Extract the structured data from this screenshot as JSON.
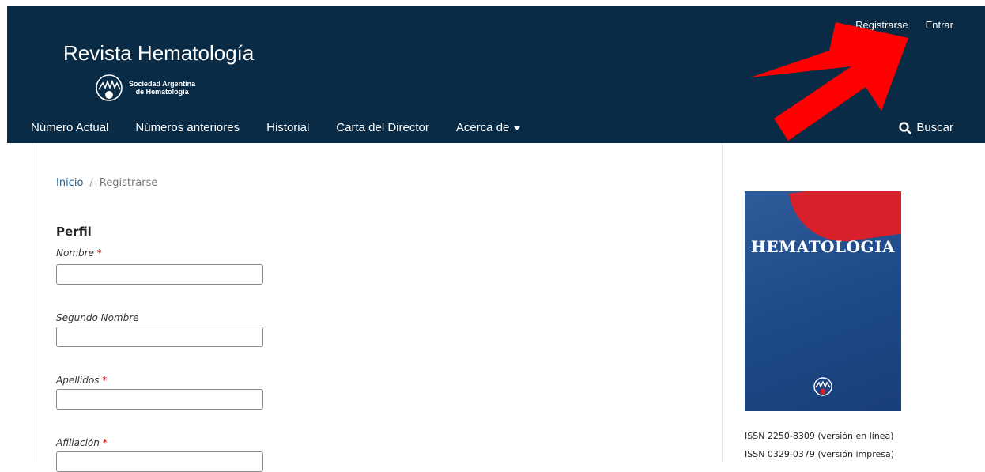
{
  "header": {
    "site_title": "Revista Hematología",
    "logo_line1": "Sociedad Argentina",
    "logo_line2": "de Hematología",
    "user_nav": {
      "register": "Registrarse",
      "login": "Entrar"
    },
    "nav_items": [
      "Número Actual",
      "Números anteriores",
      "Historial",
      "Carta del Director",
      "Acerca de"
    ],
    "search_label": "Buscar"
  },
  "breadcrumb": {
    "home": "Inicio",
    "separator": "/",
    "current": "Registrarse"
  },
  "form": {
    "legend": "Perfil",
    "fields": [
      {
        "label": "Nombre",
        "required": "*"
      },
      {
        "label": "Segundo Nombre",
        "required": ""
      },
      {
        "label": "Apellidos",
        "required": "*"
      },
      {
        "label": "Afiliación",
        "required": "*"
      }
    ]
  },
  "sidebar": {
    "cover_title": "HEMATOLOGIA",
    "issn_online": "ISSN 2250-8309 (versión en línea)",
    "issn_print": "ISSN 0329-0379 (versión impresa)"
  },
  "colors": {
    "header_bg": "#0a2b46",
    "link": "#1e6292",
    "required": "#dd0000",
    "annotation_arrow": "#ff0000"
  }
}
